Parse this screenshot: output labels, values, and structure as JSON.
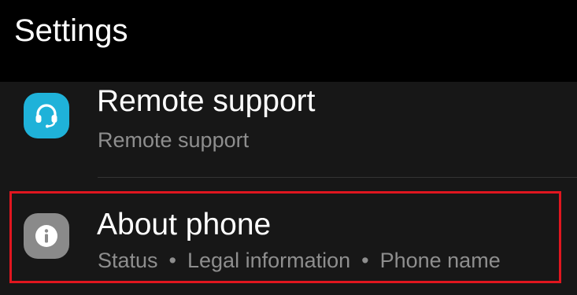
{
  "header": {
    "title": "Settings"
  },
  "items": [
    {
      "title": "Remote support",
      "summary": "Remote support",
      "icon": "headset-icon",
      "icon_color": "#1fb2d9"
    },
    {
      "title": "About phone",
      "summary_parts": [
        "Status",
        "Legal information",
        "Phone name"
      ],
      "separator": "•",
      "icon": "info-icon",
      "icon_color": "#8a8a8a"
    }
  ],
  "highlight": {
    "color": "#e0161f",
    "target": "About phone"
  }
}
